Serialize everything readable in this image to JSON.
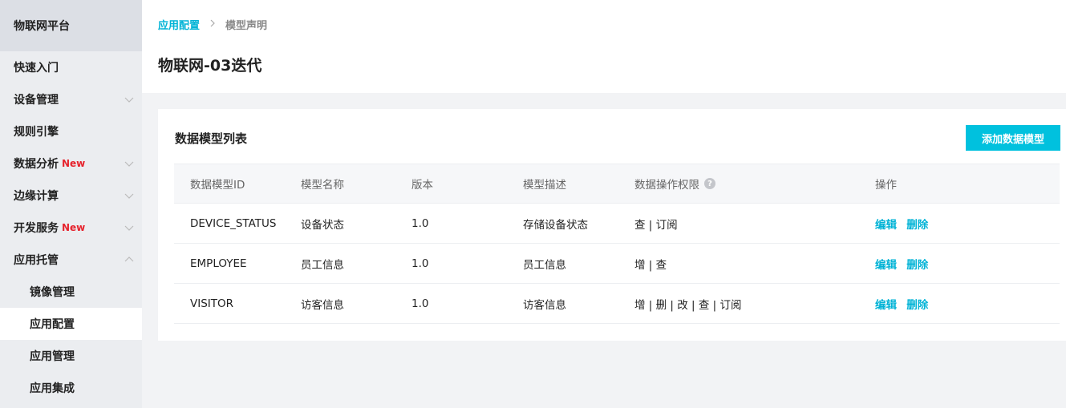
{
  "sidebar": {
    "brand": "物联网平台",
    "items": [
      {
        "label": "快速入门",
        "new": "",
        "chevron": "none"
      },
      {
        "label": "设备管理",
        "new": "",
        "chevron": "down"
      },
      {
        "label": "规则引擎",
        "new": "",
        "chevron": "none"
      },
      {
        "label": "数据分析",
        "new": "New",
        "chevron": "down"
      },
      {
        "label": "边缘计算",
        "new": "",
        "chevron": "down"
      },
      {
        "label": "开发服务",
        "new": "New",
        "chevron": "down"
      },
      {
        "label": "应用托管",
        "new": "",
        "chevron": "up"
      }
    ],
    "sub_items": [
      {
        "label": "镜像管理",
        "active": false
      },
      {
        "label": "应用配置",
        "active": true
      },
      {
        "label": "应用管理",
        "active": false
      },
      {
        "label": "应用集成",
        "active": false
      }
    ]
  },
  "breadcrumb": {
    "link": "应用配置",
    "separator": "›",
    "current": "模型声明"
  },
  "page_title": "物联网-03迭代",
  "card": {
    "title": "数据模型列表",
    "add_button": "添加数据模型"
  },
  "table": {
    "headers": [
      "数据模型ID",
      "模型名称",
      "版本",
      "模型描述",
      "数据操作权限",
      "操作"
    ],
    "help_icon": "?",
    "rows": [
      {
        "id": "DEVICE_STATUS",
        "name": "设备状态",
        "version": "1.0",
        "desc": "存储设备状态",
        "perm": "查 | 订阅",
        "edit": "编辑",
        "delete": "删除"
      },
      {
        "id": "EMPLOYEE",
        "name": "员工信息",
        "version": "1.0",
        "desc": "员工信息",
        "perm": "增 | 查",
        "edit": "编辑",
        "delete": "删除"
      },
      {
        "id": "VISITOR",
        "name": "访客信息",
        "version": "1.0",
        "desc": "访客信息",
        "perm": "增 | 删 | 改 | 查 | 订阅",
        "edit": "编辑",
        "delete": "删除"
      }
    ]
  },
  "colors": {
    "accent": "#00c1de",
    "link": "#00b3d6",
    "new_badge": "#e6232d",
    "sidebar_bg": "#ebedf0",
    "brand_bg": "#dcdfe5",
    "page_bg": "#f2f3f5"
  }
}
